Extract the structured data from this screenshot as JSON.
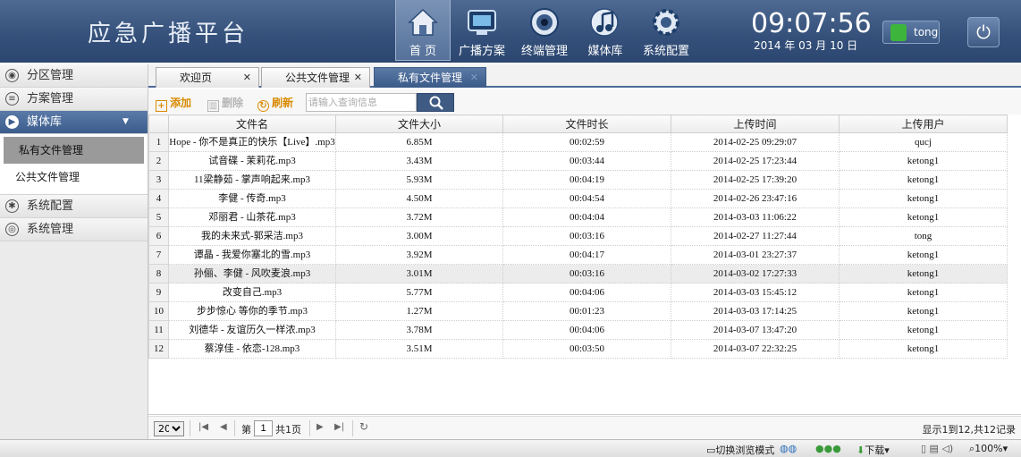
{
  "header": {
    "app_title": "应急广播平台",
    "nav": [
      {
        "label": "首 页",
        "icon": "home-icon"
      },
      {
        "label": "广播方案",
        "icon": "broadcast-plan-icon"
      },
      {
        "label": "终端管理",
        "icon": "speaker-icon"
      },
      {
        "label": "媒体库",
        "icon": "music-library-icon"
      },
      {
        "label": "系统配置",
        "icon": "gear-icon"
      }
    ],
    "time": "09:07:56",
    "date": "2014 年 03 月 10 日",
    "username": "tong"
  },
  "sidebar": {
    "items": [
      {
        "label": "分区管理",
        "icon": "location-icon"
      },
      {
        "label": "方案管理",
        "icon": "list-icon"
      },
      {
        "label": "媒体库",
        "icon": "media-icon"
      },
      {
        "label": "系统配置",
        "icon": "gear-icon"
      },
      {
        "label": "系统管理",
        "icon": "eye-icon"
      }
    ],
    "subitems": [
      "私有文件管理",
      "公共文件管理"
    ]
  },
  "tabs": [
    {
      "label": "欢迎页"
    },
    {
      "label": "公共文件管理"
    },
    {
      "label": "私有文件管理"
    }
  ],
  "toolbar": {
    "add": "添加",
    "delete": "删除",
    "refresh": "刷新",
    "search_placeholder": "请输入查询信息"
  },
  "table": {
    "columns": [
      "文件名",
      "文件大小",
      "文件时长",
      "上传时间",
      "上传用户"
    ],
    "rows": [
      {
        "n": "1",
        "name": "Hope - 你不是真正的快乐【Live】.mp3",
        "size": "6.85M",
        "dur": "00:02:59",
        "time": "2014-02-25 09:29:07",
        "user": "qucj"
      },
      {
        "n": "2",
        "name": "试音碟 - 茉莉花.mp3",
        "size": "3.43M",
        "dur": "00:03:44",
        "time": "2014-02-25 17:23:44",
        "user": "ketong1"
      },
      {
        "n": "3",
        "name": "11梁静茹 - 掌声响起来.mp3",
        "size": "5.93M",
        "dur": "00:04:19",
        "time": "2014-02-25 17:39:20",
        "user": "ketong1"
      },
      {
        "n": "4",
        "name": "李健 - 传奇.mp3",
        "size": "4.50M",
        "dur": "00:04:54",
        "time": "2014-02-26 23:47:16",
        "user": "ketong1"
      },
      {
        "n": "5",
        "name": "邓丽君 - 山茶花.mp3",
        "size": "3.72M",
        "dur": "00:04:04",
        "time": "2014-03-03 11:06:22",
        "user": "ketong1"
      },
      {
        "n": "6",
        "name": "我的未来式-郭采洁.mp3",
        "size": "3.00M",
        "dur": "00:03:16",
        "time": "2014-02-27 11:27:44",
        "user": "tong"
      },
      {
        "n": "7",
        "name": "谭晶 - 我爱你塞北的雪.mp3",
        "size": "3.92M",
        "dur": "00:04:17",
        "time": "2014-03-01 23:27:37",
        "user": "ketong1"
      },
      {
        "n": "8",
        "name": "孙俪、李健 - 风吹麦浪.mp3",
        "size": "3.01M",
        "dur": "00:03:16",
        "time": "2014-03-02 17:27:33",
        "user": "ketong1"
      },
      {
        "n": "9",
        "name": "改变自己.mp3",
        "size": "5.77M",
        "dur": "00:04:06",
        "time": "2014-03-03 15:45:12",
        "user": "ketong1"
      },
      {
        "n": "10",
        "name": "步步惊心 等你的季节.mp3",
        "size": "1.27M",
        "dur": "00:01:23",
        "time": "2014-03-03 17:14:25",
        "user": "ketong1"
      },
      {
        "n": "11",
        "name": "刘德华 - 友谊历久一样浓.mp3",
        "size": "3.78M",
        "dur": "00:04:06",
        "time": "2014-03-07 13:47:20",
        "user": "ketong1"
      },
      {
        "n": "12",
        "name": "蔡淳佳 - 依恋-128.mp3",
        "size": "3.51M",
        "dur": "00:03:50",
        "time": "2014-03-07 22:32:25",
        "user": "ketong1"
      }
    ]
  },
  "pager": {
    "page_size": "20",
    "page_prefix": "第",
    "current_page": "1",
    "page_total": "共1页",
    "summary": "显示1到12,共12记录"
  },
  "statusbar": {
    "browse_mode": "切换浏览模式",
    "download": "下载",
    "zoom": "100%"
  }
}
